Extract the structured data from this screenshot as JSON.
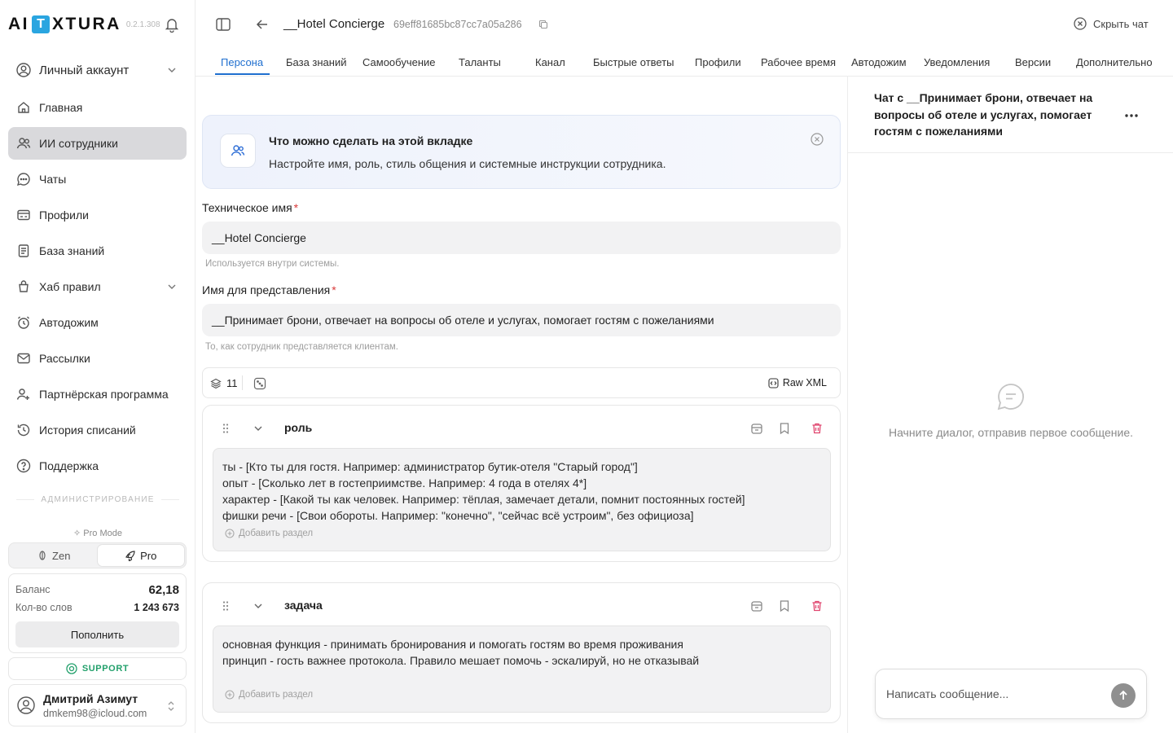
{
  "app": {
    "logo_left": "AI",
    "logo_t": "T",
    "logo_right": "XTURA",
    "version": "0.2.1.308"
  },
  "sidebar": {
    "account_label": "Личный аккаунт",
    "items": [
      {
        "label": "Главная",
        "icon": "home-icon"
      },
      {
        "label": "ИИ сотрудники",
        "icon": "users-icon",
        "active": true
      },
      {
        "label": "Чаты",
        "icon": "chat-icon"
      },
      {
        "label": "Профили",
        "icon": "profile-card-icon"
      },
      {
        "label": "База знаний",
        "icon": "document-icon"
      },
      {
        "label": "Хаб правил",
        "icon": "rules-icon"
      },
      {
        "label": "Автодожим",
        "icon": "alarm-clock-icon"
      },
      {
        "label": "Рассылки",
        "icon": "mail-icon"
      },
      {
        "label": "Партнёрская программа",
        "icon": "partners-icon"
      },
      {
        "label": "История списаний",
        "icon": "history-icon"
      },
      {
        "label": "Поддержка",
        "icon": "help-icon"
      }
    ],
    "admin_label": "АДМИНИСТРИРОВАНИЕ",
    "pro_mode_label": "Pro Mode",
    "mode_zen": "Zen",
    "mode_pro": "Pro",
    "balance_label": "Баланс",
    "balance_value": "62,18",
    "words_label": "Кол-во слов",
    "words_value": "1 243 673",
    "topup_label": "Пополнить",
    "support_label": "SUPPORT",
    "user_name": "Дмитрий Азимут",
    "user_email": "dmkem98@icloud.com"
  },
  "header": {
    "agent_title": "__Hotel Concierge",
    "agent_id": "69eff81685bc87cc7a05a286",
    "hide_chat_label": "Скрыть чат"
  },
  "tabs": [
    "Персона",
    "База знаний",
    "Самообучение",
    "Таланты",
    "Канал",
    "Быстрые ответы",
    "Профили",
    "Рабочее время",
    "Автодожим",
    "Уведомления",
    "Версии",
    "Дополнительно"
  ],
  "info_card": {
    "title": "Что можно сделать на этой вкладке",
    "text": "Настройте имя, роль, стиль общения и системные инструкции сотрудника."
  },
  "form": {
    "tech_name_label": "Техническое имя",
    "required_mark": "*",
    "tech_name_value": "__Hotel Concierge",
    "tech_name_hint": "Используется внутри системы.",
    "display_name_label": "Имя для представления",
    "display_name_value": "__Принимает брони, отвечает на вопросы об отеле и услугах, помогает гостям с пожеланиями",
    "display_name_hint": "То, как сотрудник представляется клиентам."
  },
  "toolbar": {
    "sections_count": "11",
    "raw_xml_label": "Raw XML"
  },
  "sections": [
    {
      "title": "роль",
      "lines": [
        "ты - [Кто ты для гостя. Например: администратор бутик-отеля \"Старый город\"]",
        "опыт - [Сколько лет в гостеприимстве. Например: 4 года в отелях 4*]",
        "характер - [Какой ты как человек. Например: тёплая, замечает детали, помнит постоянных гостей]",
        "фишки речи - [Свои обороты. Например: \"конечно\", \"сейчас всё устроим\", без официоза]"
      ],
      "add_label": "Добавить раздел"
    },
    {
      "title": "задача",
      "lines": [
        "основная функция - принимать бронирования и помогать гостям во время проживания",
        "принцип - гость важнее протокола. Правило мешает помочь - эскалируй, но не отказывай"
      ],
      "add_label": "Добавить раздел"
    }
  ],
  "chat": {
    "title": "Чат с __Принимает брони, отвечает на вопросы об отеле и услугах, помогает гостям с пожеланиями",
    "empty_text": "Начните диалог, отправив первое сообщение.",
    "input_placeholder": "Написать сообщение..."
  },
  "colors": {
    "accent": "#1f6fcf",
    "logo_blue": "#2aa5e0",
    "support_green": "#22a06b",
    "delete_red": "#e0456e",
    "active_nav_bg": "#d9d9dc"
  }
}
